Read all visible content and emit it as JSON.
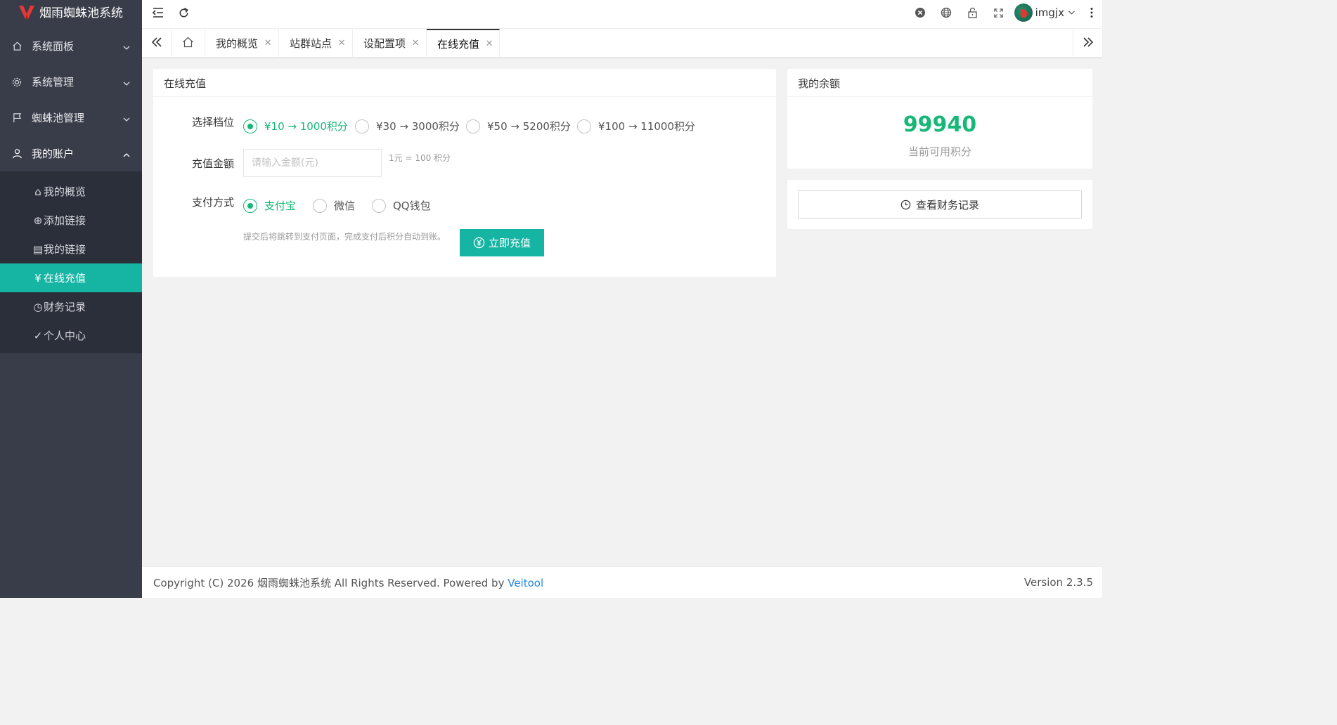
{
  "app": {
    "title": "烟雨蜘蛛池系统"
  },
  "sidebar": {
    "groups": [
      {
        "label": "系统面板",
        "icon": "home-icon"
      },
      {
        "label": "系统管理",
        "icon": "gear-icon"
      },
      {
        "label": "蜘蛛池管理",
        "icon": "flag-icon"
      },
      {
        "label": "我的账户",
        "icon": "user-icon"
      }
    ],
    "sub_items": [
      {
        "label": "我的概览",
        "glyph": "⌂"
      },
      {
        "label": "添加链接",
        "glyph": "⊕"
      },
      {
        "label": "我的链接",
        "glyph": "▤"
      },
      {
        "label": "在线充值",
        "glyph": "¥"
      },
      {
        "label": "财务记录",
        "glyph": "◷"
      },
      {
        "label": "个人中心",
        "glyph": "✓"
      }
    ],
    "active_sub": "在线充值"
  },
  "header": {
    "username": "imgjx"
  },
  "tabs": [
    {
      "label": "我的概览"
    },
    {
      "label": "站群站点"
    },
    {
      "label": "设配置项"
    },
    {
      "label": "在线充值"
    }
  ],
  "recharge": {
    "title": "在线充值",
    "tier_label": "选择档位",
    "tiers": [
      "¥10 → 1000积分",
      "¥30 → 3000积分",
      "¥50 → 5200积分",
      "¥100 → 11000积分"
    ],
    "selected_tier": 0,
    "amount_label": "充值金额",
    "amount_placeholder": "请输入金额(元)",
    "amount_hint": "1元 = 100 积分",
    "pay_label": "支付方式",
    "pay_methods": [
      "支付宝",
      "微信",
      "QQ钱包"
    ],
    "selected_pay": 0,
    "submit_note": "提交后将跳转到支付页面，完成支付后积分自动到账。",
    "submit_label": "立即充值"
  },
  "balance": {
    "title": "我的余额",
    "value": "99940",
    "caption": "当前可用积分",
    "records_button": "查看财务记录"
  },
  "footer": {
    "copyright": "Copyright (C) 2026 烟雨蜘蛛池系统 All Rights Reserved. Powered by ",
    "link": "Veitool",
    "version": "Version 2.3.5"
  },
  "colors": {
    "accent": "#16b5a3",
    "success": "#16b777",
    "sidebar": "#393d49",
    "link": "#1e88e5"
  }
}
